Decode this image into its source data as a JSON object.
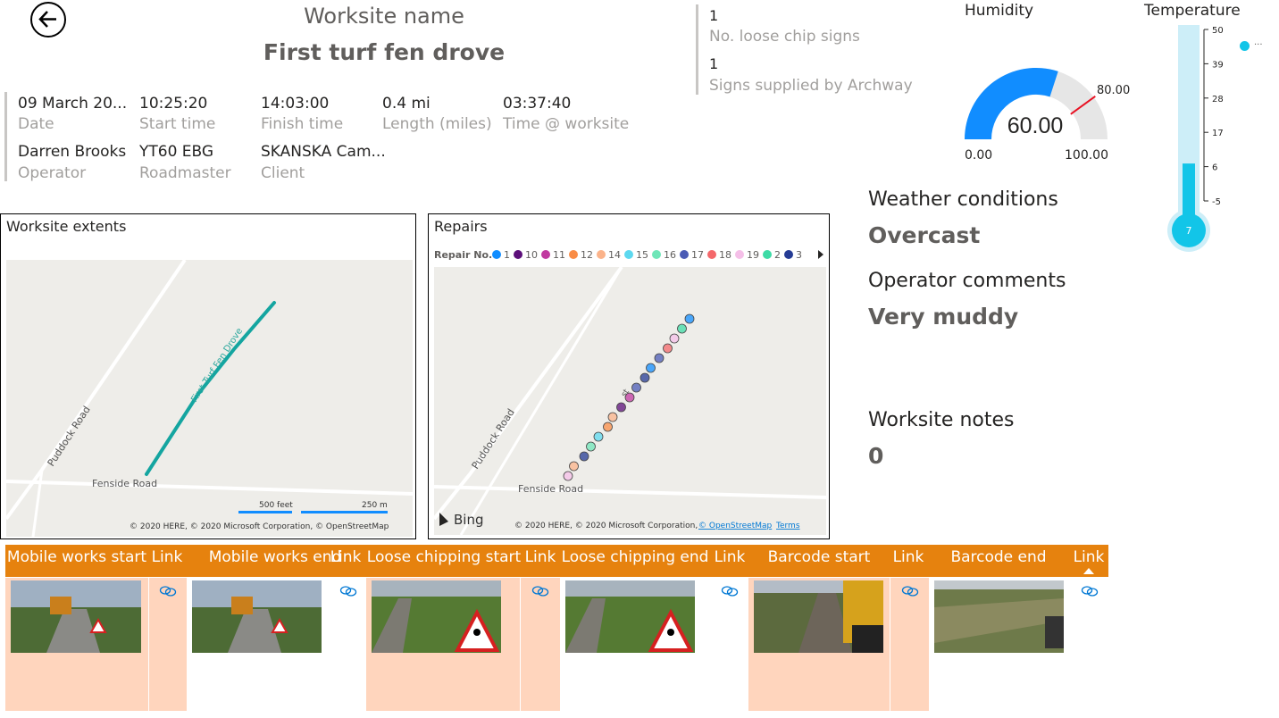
{
  "header": {
    "title_label": "Worksite name",
    "title_value": "First turf fen drove"
  },
  "details": [
    {
      "value": "09 March 20...",
      "label": "Date"
    },
    {
      "value": "10:25:20",
      "label": "Start time"
    },
    {
      "value": "14:03:00",
      "label": "Finish time"
    },
    {
      "value": "0.4 mi",
      "label": "Length (miles)"
    },
    {
      "value": "03:37:40",
      "label": "Time @ worksite"
    },
    {
      "value": "Darren Brooks",
      "label": "Operator"
    },
    {
      "value": "YT60 EBG",
      "label": "Roadmaster"
    },
    {
      "value": "SKANSKA Cam...",
      "label": "Client"
    }
  ],
  "signs": [
    {
      "value": "1",
      "label": "No. loose chip signs"
    },
    {
      "value": "1",
      "label": "Signs supplied by Archway"
    }
  ],
  "humidity": {
    "title": "Humidity",
    "value": 60,
    "value_text": "60.00",
    "min": "0.00",
    "max": "100.00",
    "target": "80.00",
    "fill_color": "#118dff",
    "target_color": "#e81123"
  },
  "temperature": {
    "title": "Temperature",
    "value": 7,
    "value_text": "7",
    "ticks": [
      "50",
      "39",
      "28",
      "17",
      "6",
      "-5"
    ],
    "legend_label": "...",
    "color": "#12c5e8"
  },
  "weather": {
    "label": "Weather conditions",
    "value": "Overcast"
  },
  "comments": {
    "label": "Operator comments",
    "value": "Very muddy"
  },
  "notes": {
    "label": "Worksite notes",
    "value": "0"
  },
  "map_extents": {
    "title": "Worksite extents",
    "roads": [
      "Puddock Road",
      "Fenside Road",
      "First Turf Fen Drove"
    ],
    "scale": [
      "500 feet",
      "250 m"
    ],
    "credits": "© 2020 HERE, © 2020 Microsoft Corporation, © OpenStreetMap"
  },
  "map_repairs": {
    "title": "Repairs",
    "legend_title": "Repair No.",
    "legend_items": [
      {
        "label": "1",
        "color": "#118dff"
      },
      {
        "label": "10",
        "color": "#5c0f7a"
      },
      {
        "label": "11",
        "color": "#c13aa0"
      },
      {
        "label": "12",
        "color": "#f98c46"
      },
      {
        "label": "14",
        "color": "#fbb38a"
      },
      {
        "label": "15",
        "color": "#5cd8ef"
      },
      {
        "label": "16",
        "color": "#6fe6b8"
      },
      {
        "label": "17",
        "color": "#4b5bb5"
      },
      {
        "label": "18",
        "color": "#f4686b"
      },
      {
        "label": "19",
        "color": "#f5bfe8"
      },
      {
        "label": "2",
        "color": "#3ddba6"
      },
      {
        "label": "3",
        "color": "#253b94"
      }
    ],
    "roads": [
      "Puddock Road",
      "Fenside Road",
      "st"
    ],
    "brand": "Bing",
    "credits": "© 2020 HERE, © 2020 Microsoft Corporation,",
    "credits_link": "© OpenStreetMap",
    "terms": "Terms"
  },
  "table": {
    "headers": [
      "Mobile works start",
      "Link",
      "Mobile works end",
      "Link",
      "Loose chipping start",
      "Link",
      "Loose chipping end",
      "Link",
      "Barcode start",
      "Link",
      "Barcode end",
      "Link"
    ],
    "header_color": "#e6820e",
    "highlight_color": "#ffd5bd"
  }
}
